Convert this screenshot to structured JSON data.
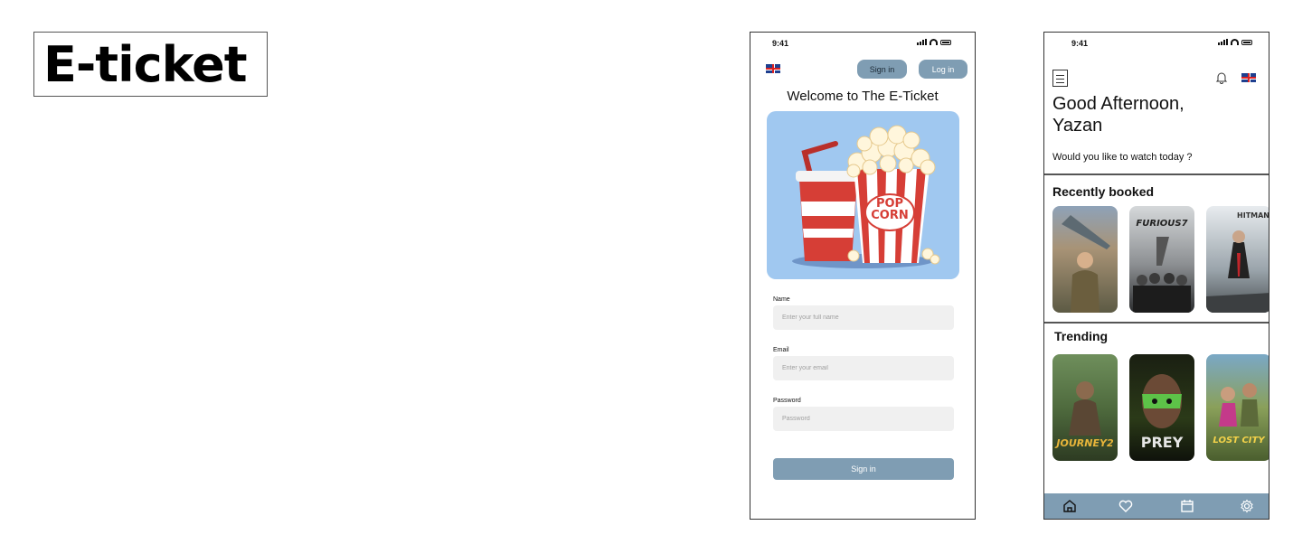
{
  "brand": {
    "title": "E-ticket"
  },
  "status": {
    "time": "9:41"
  },
  "signup": {
    "signin_button": "Sign in",
    "login_button": "Log in",
    "welcome": "Welcome to The  E-Ticket",
    "hero": {
      "line1": "POP",
      "line2": "CORN"
    },
    "fields": [
      {
        "label": "Name",
        "placeholder": "Enter your full name"
      },
      {
        "label": "Email",
        "placeholder": "Enter your email"
      },
      {
        "label": "Password",
        "placeholder": "Password"
      }
    ],
    "submit": "Sign in"
  },
  "home": {
    "greeting": "Good Afternoon, Yazan",
    "subtitle": "Would you like to watch today ?",
    "recently_booked": {
      "title": "Recently booked",
      "posters": [
        {
          "text": ""
        },
        {
          "text": "FURIOUS7"
        },
        {
          "text": "HITMAN"
        }
      ]
    },
    "trending": {
      "title": "Trending",
      "posters": [
        {
          "text": "JOURNEY2"
        },
        {
          "text": "PREY"
        },
        {
          "text": "LOST CITY"
        }
      ]
    },
    "tabs": [
      "home-icon",
      "heart-icon",
      "calendar-icon",
      "settings-icon"
    ]
  },
  "colors": {
    "accent": "#7f9db3",
    "hero_bg": "#a0c8f0",
    "input_bg": "#f0f0f0"
  }
}
